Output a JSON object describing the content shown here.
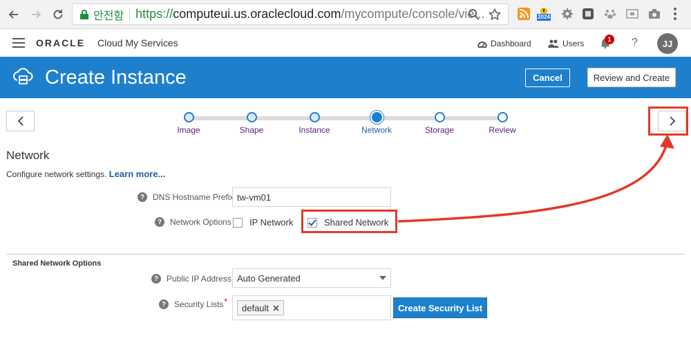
{
  "browser": {
    "secure_label": "안전함",
    "url_protocol": "https://",
    "url_host": "computeui.us.oraclecloud.com",
    "url_path": "/mycompute/console/vie...",
    "ext_badge": "2024"
  },
  "header": {
    "logo": "ORACLE",
    "app_name": "Cloud My Services",
    "dashboard_label": "Dashboard",
    "users_label": "Users",
    "notification_count": "1",
    "help_label": "?",
    "avatar_initials": "JJ"
  },
  "banner": {
    "title": "Create Instance",
    "cancel_label": "Cancel",
    "review_label": "Review and Create",
    "color": "#1e80cc"
  },
  "train": {
    "steps": [
      {
        "label": "Image",
        "state": "done"
      },
      {
        "label": "Shape",
        "state": "done"
      },
      {
        "label": "Instance",
        "state": "done"
      },
      {
        "label": "Network",
        "state": "current"
      },
      {
        "label": "Storage",
        "state": "todo"
      },
      {
        "label": "Review",
        "state": "todo"
      }
    ]
  },
  "network": {
    "title": "Network",
    "description": "Configure network settings.",
    "learn_more": "Learn more...",
    "dns_label": "DNS Hostname Prefix",
    "dns_value": "tw-vm01",
    "options_label": "Network Options",
    "ip_network_label": "IP Network",
    "ip_network_checked": false,
    "shared_network_label": "Shared Network",
    "shared_network_checked": true
  },
  "shared": {
    "title": "Shared Network Options",
    "public_ip_label": "Public IP Address",
    "public_ip_value": "Auto Generated",
    "security_lists_label": "Security Lists",
    "required_mark": "*",
    "security_list_chip": "default",
    "create_button": "Create Security List"
  },
  "annotation": {
    "color": "#e13a2b"
  }
}
